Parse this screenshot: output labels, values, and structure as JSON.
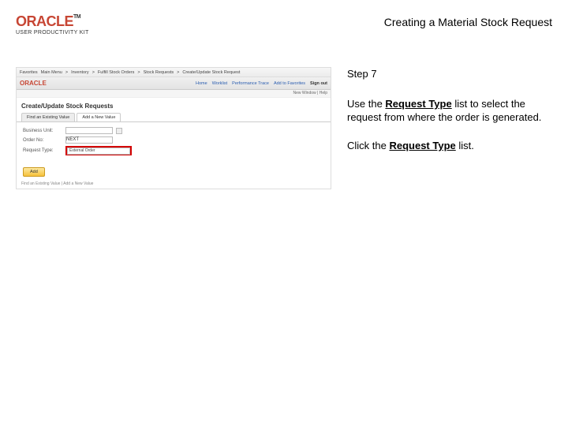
{
  "header": {
    "logo_text": "ORACLE",
    "tm": "TM",
    "upk": "USER PRODUCTIVITY KIT",
    "doc_title": "Creating a Material Stock Request"
  },
  "screenshot": {
    "breadcrumb": [
      "Favorites",
      "Main Menu",
      "Inventory",
      "Fulfill Stock Orders",
      "Stock Requests",
      "Create/Update Stock Request"
    ],
    "mini_logo": "ORACLE",
    "nav_links": [
      "Home",
      "Worklist",
      "Performance Trace",
      "Add to Favorites",
      "Sign out"
    ],
    "subbar": "New Window | Help",
    "page_title": "Create/Update Stock Requests",
    "tabs": [
      "Find an Existing Value",
      "Add a New Value"
    ],
    "form": {
      "business_unit_label": "Business Unit:",
      "business_unit_value": "",
      "order_no_label": "Order No:",
      "order_no_value": "NEXT",
      "request_type_label": "Request Type:",
      "request_type_value": "External Order"
    },
    "add_button": "Add",
    "footer": "Find an Existing Value | Add a New Value"
  },
  "instructions": {
    "step": "Step 7",
    "para1_a": "Use the ",
    "para1_b": "Request Type",
    "para1_c": " list to select the request from where the order is generated.",
    "para2_a": "Click the ",
    "para2_b": "Request Type",
    "para2_c": " list."
  }
}
